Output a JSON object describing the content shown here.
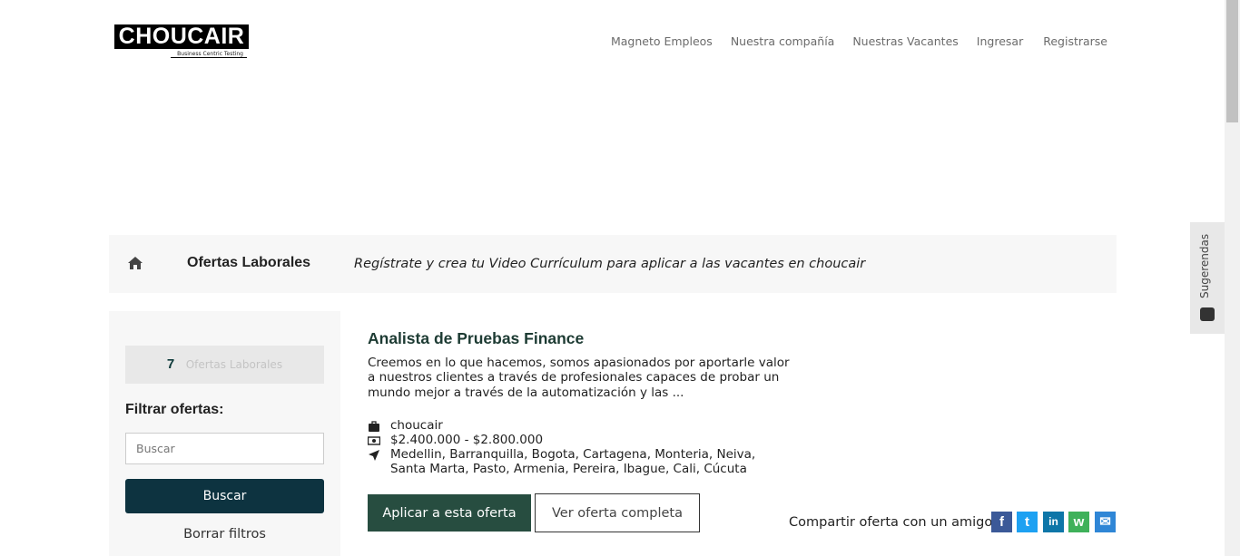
{
  "header": {
    "logo_text": "CHOUCAIR",
    "logo_tagline": "Business Centric Testing",
    "nav": [
      {
        "label": "Magneto Empleos"
      },
      {
        "label": "Nuestra compañía"
      },
      {
        "label": "Nuestras Vacantes"
      },
      {
        "label": "Ingresar"
      },
      {
        "label": "Registrarse"
      }
    ]
  },
  "banner": {
    "home_icon": "home-icon",
    "title": "Ofertas Laborales",
    "message": "Regístrate y crea tu Video Currículum para aplicar a las vacantes en choucair"
  },
  "sidebar": {
    "count": "7",
    "count_label": "Ofertas Laborales",
    "filter_title": "Filtrar ofertas:",
    "search_placeholder": "Buscar",
    "search_button": "Buscar",
    "clear_filters": "Borrar filtros"
  },
  "job": {
    "title": "Analista de Pruebas Finance",
    "description": "Creemos en lo que hacemos, somos apasionados por aportarle valor a nuestros clientes a través de profesionales capaces de probar un mundo mejor a través de la automatización y las ...",
    "company": "choucair",
    "salary": "$2.400.000 - $2.800.000",
    "locations": "Medellin, Barranquilla, Bogota, Cartagena, Monteria, Neiva, Santa Marta, Pasto, Armenia, Pereira, Ibague, Cali, Cúcuta",
    "apply_button": "Aplicar a esta oferta",
    "view_button": "Ver oferta completa",
    "share_label": "Compartir oferta con un amigo",
    "social": [
      {
        "name": "facebook",
        "glyph": "f",
        "color": "#3b5998"
      },
      {
        "name": "twitter",
        "glyph": "t",
        "color": "#1da1f2"
      },
      {
        "name": "linkedin",
        "glyph": "in",
        "color": "#0e76a8"
      },
      {
        "name": "whatsapp",
        "glyph": "w",
        "color": "#3fb15a"
      },
      {
        "name": "email",
        "glyph": "✉",
        "color": "#2f86d6"
      }
    ]
  },
  "suggestions": {
    "label": "Sugerendas"
  },
  "colors": {
    "primary_dark": "#0d3340",
    "apply_green": "#274d40",
    "panel_bg": "#f7f7f7"
  }
}
